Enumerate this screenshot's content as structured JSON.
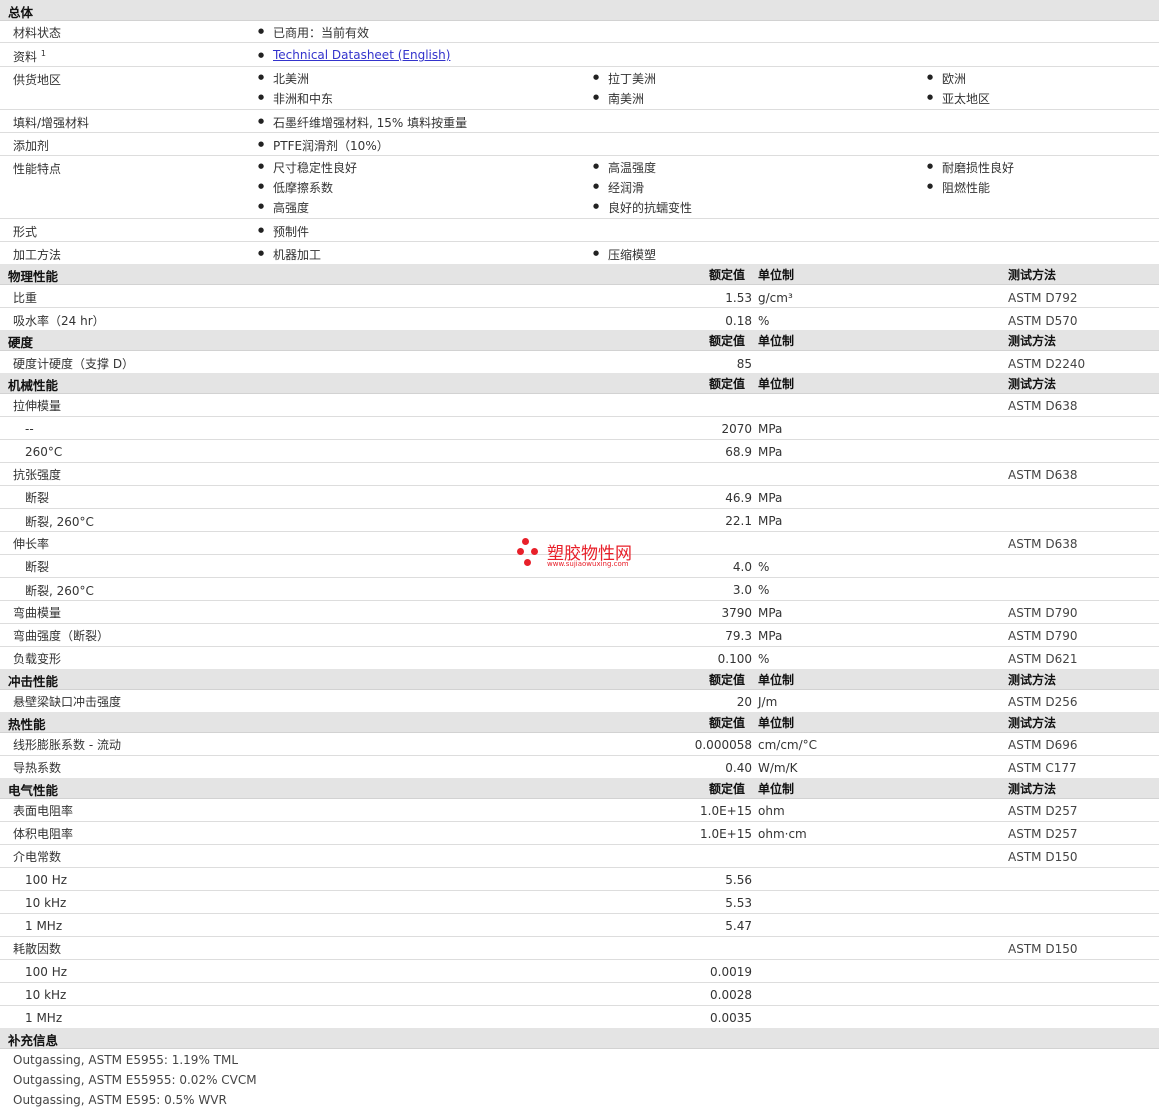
{
  "cols": {
    "val": "额定值",
    "unit": "单位制",
    "method": "测试方法"
  },
  "general": {
    "title": "总体",
    "status_label": "材料状态",
    "status_value": "已商用：当前有效",
    "doc_label": "资料",
    "doc_sup": "1",
    "doc_link": "Technical Datasheet (English)",
    "region_label": "供货地区",
    "regions": [
      "北美洲",
      "拉丁美洲",
      "欧洲",
      "非洲和中东",
      "南美洲",
      "亚太地区"
    ],
    "filler_label": "填料/增强材料",
    "filler_value": "石墨纤维增强材料, 15% 填料按重量",
    "additive_label": "添加剂",
    "additive_value": "PTFE润滑剂（10%）",
    "features_label": "性能特点",
    "features": [
      "尺寸稳定性良好",
      "高温强度",
      "耐磨损性良好",
      "低摩擦系数",
      "经润滑",
      "阻燃性能",
      "高强度",
      "良好的抗蠕变性"
    ],
    "form_label": "形式",
    "form_value": "预制件",
    "process_label": "加工方法",
    "process": [
      "机器加工",
      "压缩模塑"
    ]
  },
  "physical": {
    "title": "物理性能",
    "rows": [
      {
        "label": "比重",
        "value": "1.53",
        "unit": "g/cm³",
        "method": "ASTM D792"
      },
      {
        "label": "吸水率（24 hr）",
        "value": "0.18",
        "unit": "%",
        "method": "ASTM D570"
      }
    ]
  },
  "hardness": {
    "title": "硬度",
    "rows": [
      {
        "label": "硬度计硬度（支撑 D）",
        "value": "85",
        "unit": "",
        "method": "ASTM D2240"
      }
    ]
  },
  "mechanical": {
    "title": "机械性能",
    "tm": {
      "label": "拉伸模量",
      "method": "ASTM D638",
      "s1": "--",
      "v1": "2070",
      "u1": "MPa",
      "s2": "260°C",
      "v2": "68.9",
      "u2": "MPa"
    },
    "ts": {
      "label": "抗张强度",
      "method": "ASTM D638",
      "s1": "断裂",
      "v1": "46.9",
      "u1": "MPa",
      "s2": "断裂, 260°C",
      "v2": "22.1",
      "u2": "MPa"
    },
    "el": {
      "label": "伸长率",
      "method": "ASTM D638",
      "s1": "断裂",
      "v1": "4.0",
      "u1": "%",
      "s2": "断裂, 260°C",
      "v2": "3.0",
      "u2": "%"
    },
    "fm": {
      "label": "弯曲模量",
      "value": "3790",
      "unit": "MPa",
      "method": "ASTM D790"
    },
    "fs": {
      "label": "弯曲强度（断裂）",
      "value": "79.3",
      "unit": "MPa",
      "method": "ASTM D790"
    },
    "dl": {
      "label": "负载变形",
      "value": "0.100",
      "unit": "%",
      "method": "ASTM D621"
    }
  },
  "impact": {
    "title": "冲击性能",
    "rows": [
      {
        "label": "悬壁梁缺口冲击强度",
        "value": "20",
        "unit": "J/m",
        "method": "ASTM D256"
      }
    ]
  },
  "thermal": {
    "title": "热性能",
    "rows": [
      {
        "label": "线形膨胀系数 - 流动",
        "value": "0.000058",
        "unit": "cm/cm/°C",
        "method": "ASTM D696"
      },
      {
        "label": "导热系数",
        "value": "0.40",
        "unit": "W/m/K",
        "method": "ASTM C177"
      }
    ]
  },
  "electrical": {
    "title": "电气性能",
    "sr": {
      "label": "表面电阻率",
      "value": "1.0E+15",
      "unit": "ohm",
      "method": "ASTM D257"
    },
    "vr": {
      "label": "体积电阻率",
      "value": "1.0E+15",
      "unit": "ohm·cm",
      "method": "ASTM D257"
    },
    "dc": {
      "label": "介电常数",
      "method": "ASTM D150",
      "subs": [
        [
          "100 Hz",
          "5.56"
        ],
        [
          "10 kHz",
          "5.53"
        ],
        [
          "1 MHz",
          "5.47"
        ]
      ]
    },
    "df": {
      "label": "耗散因数",
      "method": "ASTM D150",
      "subs": [
        [
          "100 Hz",
          "0.0019"
        ],
        [
          "10 kHz",
          "0.0028"
        ],
        [
          "1 MHz",
          "0.0035"
        ]
      ]
    }
  },
  "supplement": {
    "title": "补充信息",
    "lines": [
      "Outgassing, ASTM E5955: 1.19% TML",
      "Outgassing, ASTM E55955: 0.02% CVCM",
      "Outgassing, ASTM E595: 0.5% WVR"
    ]
  },
  "watermark": {
    "text": "塑胶物性网",
    "url": "www.sujiaowuxing.com",
    "color": "#e8202a"
  }
}
